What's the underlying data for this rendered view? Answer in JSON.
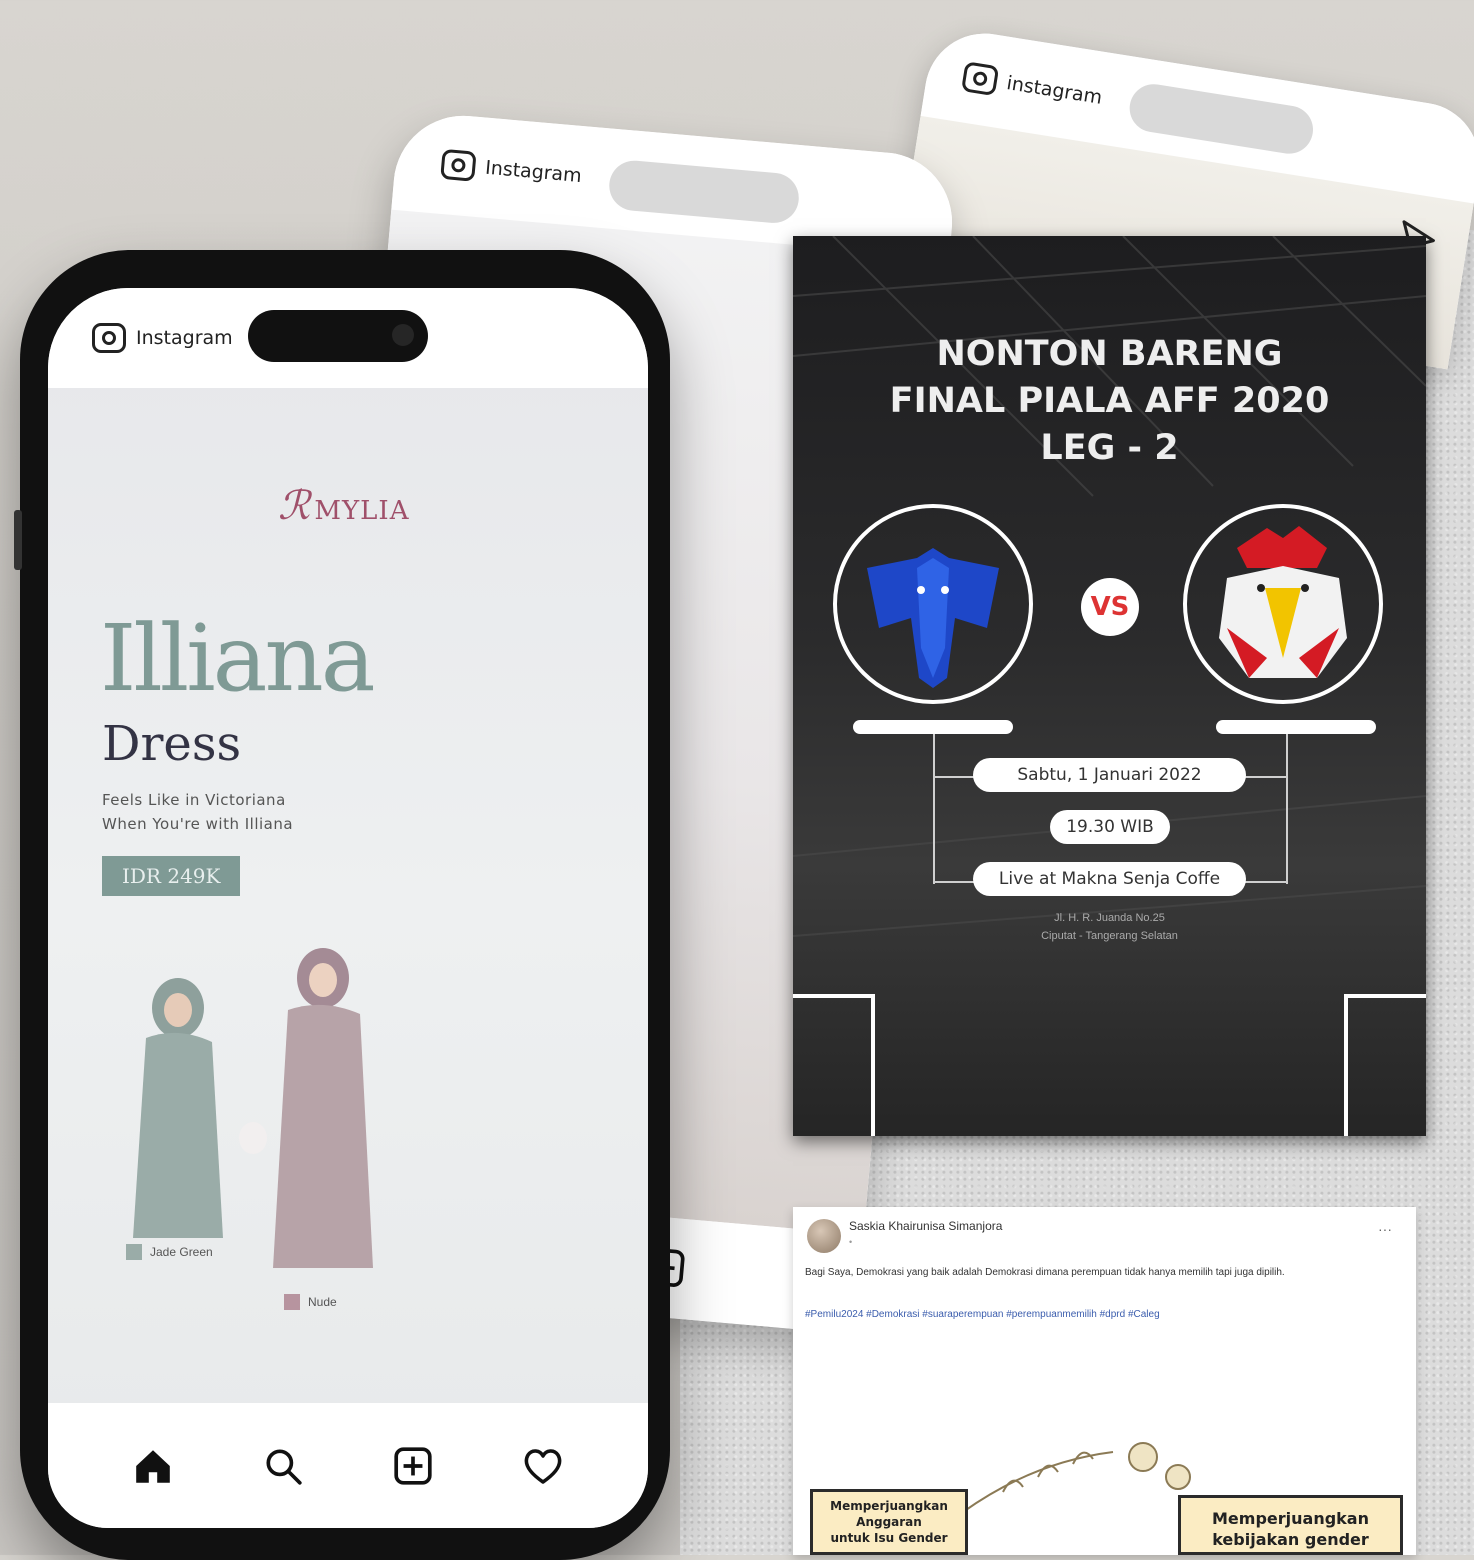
{
  "instagram": {
    "label": "Instagram",
    "label_back": "instagram"
  },
  "front_phone": {
    "brand": "MYLIA",
    "title": "Illiana",
    "subtitle": "Dress",
    "tagline_1": "Feels Like in Victoriana",
    "tagline_2": "When You're with Illiana",
    "price": "IDR 249K",
    "swatches": [
      {
        "label": "Jade Green",
        "color": "#9aaca8"
      },
      {
        "label": "Nude",
        "color": "#b7949f"
      }
    ]
  },
  "poster": {
    "title_line1": "NONTON BARENG",
    "title_line2": "FINAL PIALA AFF 2020",
    "title_line3": "LEG - 2",
    "vs": "VS",
    "date": "Sabtu, 1 Januari 2022",
    "time": "19.30 WIB",
    "venue": "Live at Makna Senja Coffe",
    "address_line1": "Jl. H. R. Juanda No.25",
    "address_line2": "Ciputat - Tangerang Selatan"
  },
  "fb_post": {
    "author": "Saskia Khairunisa Simanjora",
    "body": "Bagi Saya, Demokrasi yang baik adalah Demokrasi dimana perempuan tidak hanya memilih tapi juga dipilih.",
    "hashtags": "#Pemilu2024 #Demokrasi #suaraperempuan #perempuanmemilih #dprd #Caleg",
    "notes": [
      {
        "line1": "Memperjuangkan",
        "line2": "Anggaran",
        "line3": "untuk Isu Gender"
      },
      {
        "line1": "Memperjuangkan",
        "line2": "kebijakan gender"
      }
    ]
  },
  "colors": {
    "sage": "#7f9a95",
    "mauve": "#b98a9a",
    "brand": "#a0506a",
    "poster_bg": "#1d1d1f"
  }
}
